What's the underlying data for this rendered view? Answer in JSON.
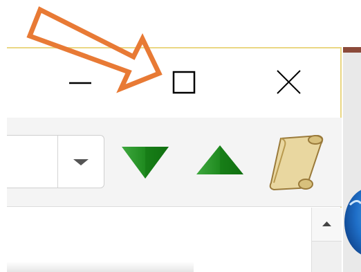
{
  "window": {
    "border_color": "#ead783",
    "controls": {
      "minimize": {
        "icon": "minimize-icon"
      },
      "maximize": {
        "icon": "maximize-icon"
      },
      "close": {
        "icon": "close-icon"
      }
    }
  },
  "toolbar": {
    "combo": {
      "value": "",
      "placeholder": "",
      "arrow_icon": "chevron-down-icon"
    },
    "buttons": [
      {
        "name": "move-down",
        "icon": "green-triangle-down-icon",
        "color": "#1f8a1f"
      },
      {
        "name": "move-up",
        "icon": "green-triangle-up-icon",
        "color": "#1f8a1f"
      },
      {
        "name": "scroll",
        "icon": "parchment-scroll-icon",
        "color": "#e8d49a"
      }
    ]
  },
  "scrollbar": {
    "up_icon": "scroll-up-arrow-icon"
  },
  "annotation": {
    "arrow_color": "#e87a35",
    "points_to": "maximize-button"
  }
}
